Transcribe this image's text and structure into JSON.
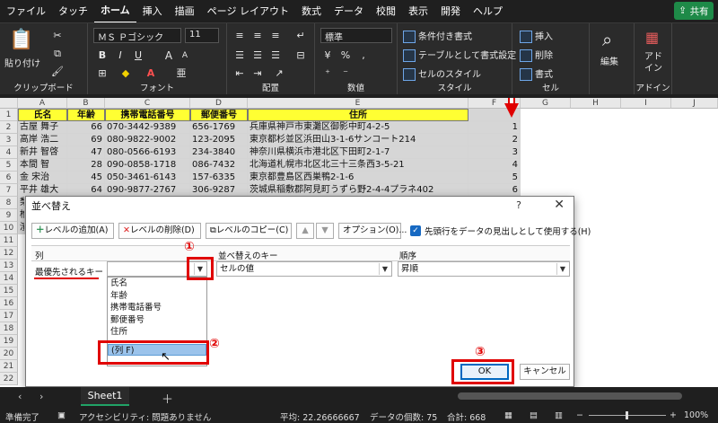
{
  "menu": [
    "ファイル",
    "タッチ",
    "ホーム",
    "挿入",
    "描画",
    "ページ レイアウト",
    "数式",
    "データ",
    "校閲",
    "表示",
    "開発",
    "ヘルプ"
  ],
  "menu_active_index": 2,
  "share_label": "共有",
  "ribbon": {
    "clipboard": {
      "paste": "貼り付け",
      "label": "クリップボード"
    },
    "font": {
      "name": "ＭＳ Ｐゴシック",
      "size": "11",
      "label": "フォント",
      "bold": "B",
      "italic": "I",
      "underline": "U",
      "grow": "A",
      "shrink": "A"
    },
    "alignment": {
      "label": "配置"
    },
    "number": {
      "format": "標準",
      "label": "数値"
    },
    "styles": {
      "conditional": "条件付き書式",
      "table": "テーブルとして書式設定",
      "cell": "セルのスタイル",
      "label": "スタイル"
    },
    "cells": {
      "insert": "挿入",
      "delete": "削除",
      "format": "書式",
      "label": "セル"
    },
    "editing": {
      "label": "編集"
    },
    "addins": {
      "label1": "アド",
      "label2": "イン",
      "label": "アドイン"
    }
  },
  "columns": [
    "A",
    "B",
    "C",
    "D",
    "E",
    "F",
    "G",
    "H",
    "I",
    "J"
  ],
  "rows": [
    "1",
    "2",
    "3",
    "4",
    "5",
    "6",
    "7",
    "8",
    "9",
    "10",
    "11",
    "12",
    "13",
    "14",
    "15",
    "16",
    "17",
    "18",
    "19",
    "20",
    "21",
    "22"
  ],
  "headers": [
    "氏名",
    "年齢",
    "携帯電話番号",
    "郵便番号",
    "住所"
  ],
  "data_rows": [
    {
      "name": "古屋 舞子",
      "age": "66",
      "phone": "070-3442-9389",
      "zip": "656-1769",
      "addr": "兵庫県神戸市東灘区御影中町4-2-5",
      "f": "1"
    },
    {
      "name": "高岸 浩二",
      "age": "69",
      "phone": "080-9822-9002",
      "zip": "123-2095",
      "addr": "東京都杉並区浜田山3-1-6サンコート214",
      "f": "2"
    },
    {
      "name": "新井 智啓",
      "age": "47",
      "phone": "080-0566-6193",
      "zip": "234-3840",
      "addr": "神奈川県横浜市港北区下田町2-1-7",
      "f": "3"
    },
    {
      "name": "本間 智",
      "age": "28",
      "phone": "090-0858-1718",
      "zip": "086-7432",
      "addr": "北海道札幌市北区北三十三条西3-5-21",
      "f": "4"
    },
    {
      "name": "金 宋治",
      "age": "45",
      "phone": "050-3461-6143",
      "zip": "157-6335",
      "addr": "東京都豊島区西巣鴨2-1-6",
      "f": "5"
    },
    {
      "name": "平井 雄大",
      "age": "64",
      "phone": "090-9877-2767",
      "zip": "306-9287",
      "addr": "茨城県稲敷郡阿見町うずら野2-4-4プラネ402",
      "f": "6"
    }
  ],
  "row_fragments": [
    "梨",
    "椎",
    "濱"
  ],
  "dialog": {
    "title": "並べ替え",
    "help": "?",
    "close": "✕",
    "add_level": "レベルの追加(A)",
    "delete_level": "レベルの削除(D)",
    "copy_level": "レベルのコピー(C)",
    "options": "オプション(O)...",
    "header_checkbox": "先頭行をデータの見出しとして使用する(H)",
    "col_header": "列",
    "key_header": "並べ替えのキー",
    "order_header": "順序",
    "priority_label": "最優先されるキー",
    "sort_on": "セルの値",
    "order": "昇順",
    "options_list": [
      "氏名",
      "年齢",
      "携帯電話番号",
      "郵便番号",
      "住所",
      "(列 F)"
    ],
    "highlighted_option": "(列 F)",
    "ok": "OK",
    "cancel": "キャンセル"
  },
  "markers": [
    "①",
    "②",
    "③"
  ],
  "sheet_tab": "Sheet1",
  "status": {
    "ready": "準備完了",
    "accessibility": "アクセシビリティ: 問題ありません",
    "average": "平均: 22.26666667",
    "count": "データの個数: 75",
    "sum": "合計: 668",
    "zoom": "100%"
  }
}
